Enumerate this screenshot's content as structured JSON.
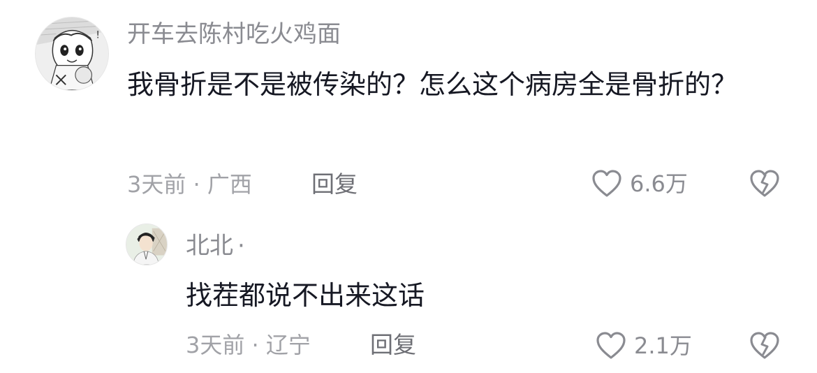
{
  "comments": [
    {
      "avatar_icon": "manga-character-avatar",
      "username": "开车去陈村吃火鸡面",
      "content": "我骨折是不是被传染的？怎么这个病房全是骨折的？",
      "time": "3天前",
      "location": "广西",
      "reply_label": "回复",
      "like_icon": "heart-outline-icon",
      "likes": "6.6万",
      "dislike_icon": "broken-heart-icon"
    },
    {
      "avatar_icon": "boy-portrait-avatar",
      "username": "北北",
      "username_suffix": "·",
      "content": "找茬都说不出来这话",
      "time": "3天前",
      "location": "辽宁",
      "reply_label": "回复",
      "like_icon": "heart-outline-icon",
      "likes": "2.1万",
      "dislike_icon": "broken-heart-icon"
    }
  ],
  "meta_separator": " · ",
  "colors": {
    "username": "#8a8b91",
    "content": "#161823",
    "meta": "#a1a2a7",
    "icon": "#8a8b91"
  }
}
